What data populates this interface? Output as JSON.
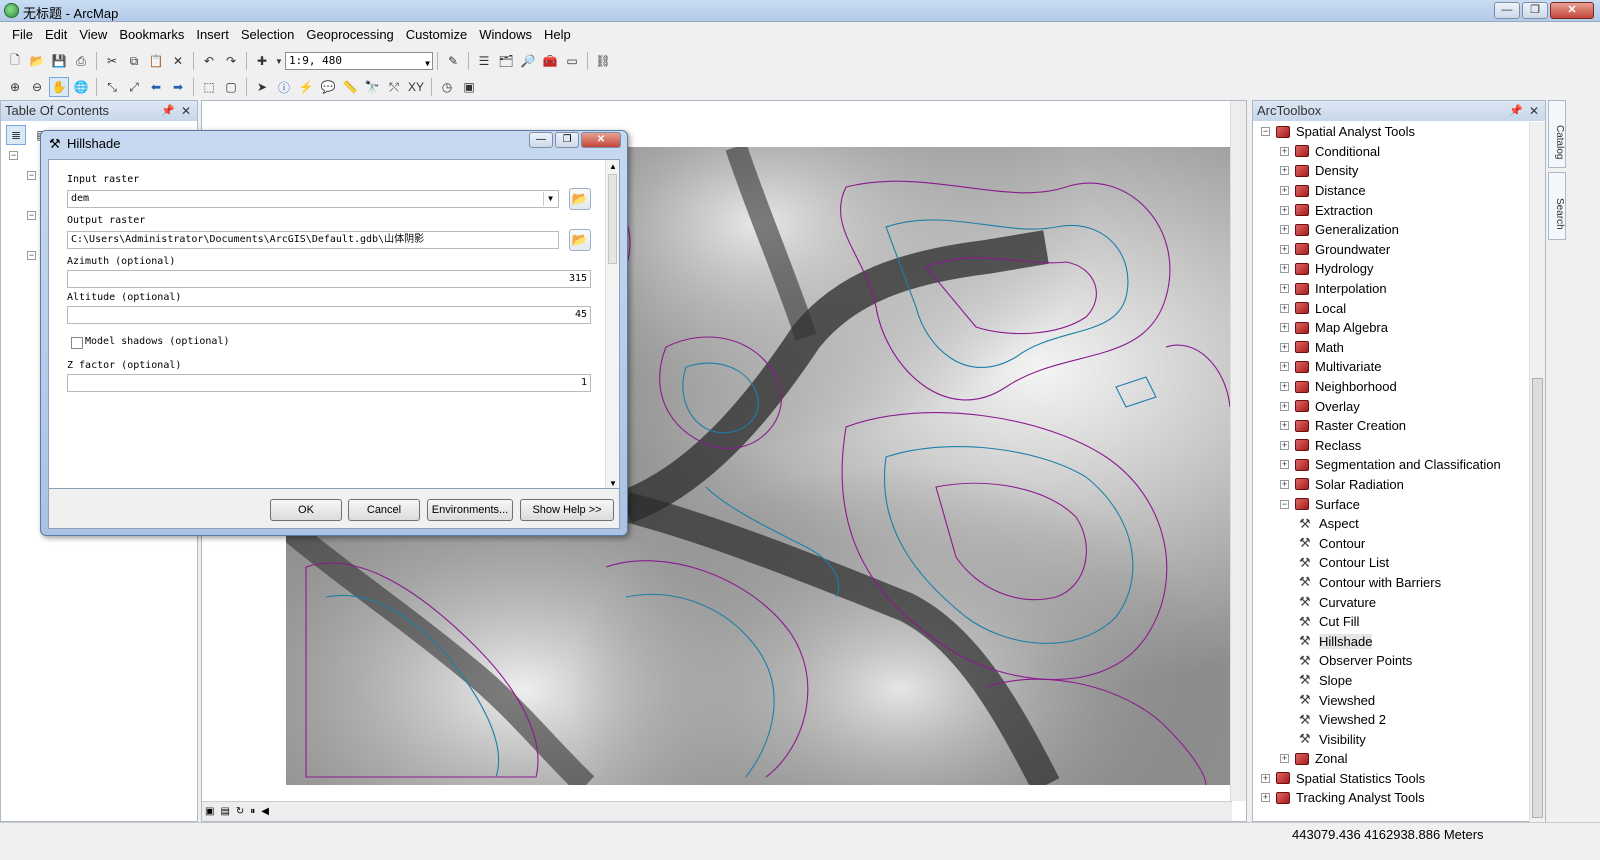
{
  "window": {
    "title": "无标题 - ArcMap"
  },
  "menu": [
    "File",
    "Edit",
    "View",
    "Bookmarks",
    "Insert",
    "Selection",
    "Geoprocessing",
    "Customize",
    "Windows",
    "Help"
  ],
  "toolbar": {
    "scale": "1:9, 480"
  },
  "toc": {
    "title": "Table Of Contents"
  },
  "toolbox": {
    "title": "ArcToolbox",
    "items": [
      {
        "label": "Spatial Analyst Tools",
        "level": 0,
        "type": "toolbox",
        "expanded": true
      },
      {
        "label": "Conditional",
        "level": 1,
        "type": "toolset",
        "expanded": false
      },
      {
        "label": "Density",
        "level": 1,
        "type": "toolset",
        "expanded": false
      },
      {
        "label": "Distance",
        "level": 1,
        "type": "toolset",
        "expanded": false
      },
      {
        "label": "Extraction",
        "level": 1,
        "type": "toolset",
        "expanded": false
      },
      {
        "label": "Generalization",
        "level": 1,
        "type": "toolset",
        "expanded": false
      },
      {
        "label": "Groundwater",
        "level": 1,
        "type": "toolset",
        "expanded": false
      },
      {
        "label": "Hydrology",
        "level": 1,
        "type": "toolset",
        "expanded": false
      },
      {
        "label": "Interpolation",
        "level": 1,
        "type": "toolset",
        "expanded": false
      },
      {
        "label": "Local",
        "level": 1,
        "type": "toolset",
        "expanded": false
      },
      {
        "label": "Map Algebra",
        "level": 1,
        "type": "toolset",
        "expanded": false
      },
      {
        "label": "Math",
        "level": 1,
        "type": "toolset",
        "expanded": false
      },
      {
        "label": "Multivariate",
        "level": 1,
        "type": "toolset",
        "expanded": false
      },
      {
        "label": "Neighborhood",
        "level": 1,
        "type": "toolset",
        "expanded": false
      },
      {
        "label": "Overlay",
        "level": 1,
        "type": "toolset",
        "expanded": false
      },
      {
        "label": "Raster Creation",
        "level": 1,
        "type": "toolset",
        "expanded": false
      },
      {
        "label": "Reclass",
        "level": 1,
        "type": "toolset",
        "expanded": false
      },
      {
        "label": "Segmentation and Classification",
        "level": 1,
        "type": "toolset",
        "expanded": false
      },
      {
        "label": "Solar Radiation",
        "level": 1,
        "type": "toolset",
        "expanded": false
      },
      {
        "label": "Surface",
        "level": 1,
        "type": "toolset",
        "expanded": true
      },
      {
        "label": "Aspect",
        "level": 2,
        "type": "tool"
      },
      {
        "label": "Contour",
        "level": 2,
        "type": "tool"
      },
      {
        "label": "Contour List",
        "level": 2,
        "type": "tool"
      },
      {
        "label": "Contour with Barriers",
        "level": 2,
        "type": "tool"
      },
      {
        "label": "Curvature",
        "level": 2,
        "type": "tool"
      },
      {
        "label": "Cut Fill",
        "level": 2,
        "type": "tool"
      },
      {
        "label": "Hillshade",
        "level": 2,
        "type": "tool",
        "selected": true
      },
      {
        "label": "Observer Points",
        "level": 2,
        "type": "tool"
      },
      {
        "label": "Slope",
        "level": 2,
        "type": "tool"
      },
      {
        "label": "Viewshed",
        "level": 2,
        "type": "tool"
      },
      {
        "label": "Viewshed 2",
        "level": 2,
        "type": "tool"
      },
      {
        "label": "Visibility",
        "level": 2,
        "type": "tool"
      },
      {
        "label": "Zonal",
        "level": 1,
        "type": "toolset",
        "expanded": false
      },
      {
        "label": "Spatial Statistics Tools",
        "level": 0,
        "type": "toolbox",
        "expanded": false
      },
      {
        "label": "Tracking Analyst Tools",
        "level": 0,
        "type": "toolbox",
        "expanded": false
      }
    ]
  },
  "side_tabs": [
    "Catalog",
    "Search"
  ],
  "status": {
    "coords": "443079.436  4162938.886 Meters"
  },
  "dialog": {
    "title": "Hillshade",
    "input_raster_label": "Input raster",
    "input_raster_value": "dem",
    "output_raster_label": "Output raster",
    "output_raster_value": "C:\\Users\\Administrator\\Documents\\ArcGIS\\Default.gdb\\山体阴影",
    "azimuth_label": "Azimuth (optional)",
    "azimuth_value": "315",
    "altitude_label": "Altitude (optional)",
    "altitude_value": "45",
    "model_shadows_label": "Model shadows (optional)",
    "model_shadows_checked": false,
    "zfactor_label": "Z factor (optional)",
    "zfactor_value": "1",
    "ok": "OK",
    "cancel": "Cancel",
    "environments": "Environments...",
    "show_help": "Show Help >>"
  },
  "colors": {
    "contour_primary": "#8b1a8f",
    "contour_secondary": "#1b7fa8",
    "selection": "#e6e6e6"
  }
}
